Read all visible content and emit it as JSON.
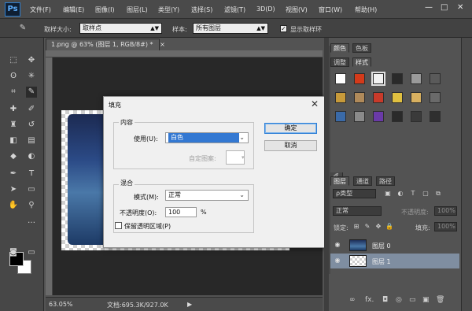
{
  "app": {
    "logo": "Ps"
  },
  "menu": [
    "文件(F)",
    "编辑(E)",
    "图像(I)",
    "图层(L)",
    "类型(Y)",
    "选择(S)",
    "滤镜(T)",
    "3D(D)",
    "视图(V)",
    "窗口(W)",
    "帮助(H)"
  ],
  "window_controls": {
    "minimize": "—",
    "maximize": "□",
    "close": "✕"
  },
  "options": {
    "sample_size_label": "取样大小:",
    "sample_size_value": "取样点",
    "sample_label": "样本:",
    "sample_value": "所有图层",
    "show_ring_label": "显示取样环",
    "show_ring_checked": true
  },
  "document": {
    "tab_title": "1.png @ 63% (图层 1, RGB/8#) *",
    "tab_close": "×",
    "zoom": "63.05%",
    "doc_info": "文档:695.3K/927.0K"
  },
  "fill_dialog": {
    "title": "填充",
    "contents_group": "内容",
    "use_label": "使用(U):",
    "use_value": "白色",
    "custom_pattern_label": "自定图案:",
    "blending_group": "混合",
    "mode_label": "模式(M):",
    "mode_value": "正常",
    "opacity_label": "不透明度(O):",
    "opacity_value": "100",
    "opacity_unit": "%",
    "preserve_label": "保留透明区域(P)",
    "preserve_checked": false,
    "ok_label": "确定",
    "cancel_label": "取消"
  },
  "panels": {
    "top_tabs": [
      "颜色",
      "色板"
    ],
    "style_tabs": [
      "调整",
      "样式"
    ],
    "layers_tabs": [
      "图层",
      "通道",
      "路径"
    ],
    "kind_filter": "ρ类型",
    "blend_mode": "正常",
    "opacity_label": "不透明度:",
    "opacity_value": "100%",
    "lock_label": "锁定:",
    "fill_label": "填充:",
    "fill_value": "100%",
    "layers": [
      {
        "name": "图层 0",
        "active": false
      },
      {
        "name": "图层 1",
        "active": true
      }
    ],
    "footer": [
      "∞",
      "fx.",
      "◘",
      "◎",
      "▭",
      "▣",
      "🗑"
    ]
  },
  "style_swatch_colors": [
    "#ffffff",
    "#d43a1a",
    "#f2f2f2",
    "#2a2a2a",
    "#9a9a9a",
    "#5a5a5a",
    "#c79a3a",
    "#b08a5a",
    "#c83a2a",
    "#e0c040",
    "#d8b060",
    "#6a6a6a",
    "#3a6aa8",
    "#8a8a8a",
    "#6a3aa8",
    "#2a2a2a",
    "#3a3a3a",
    "#2f2f2f"
  ]
}
